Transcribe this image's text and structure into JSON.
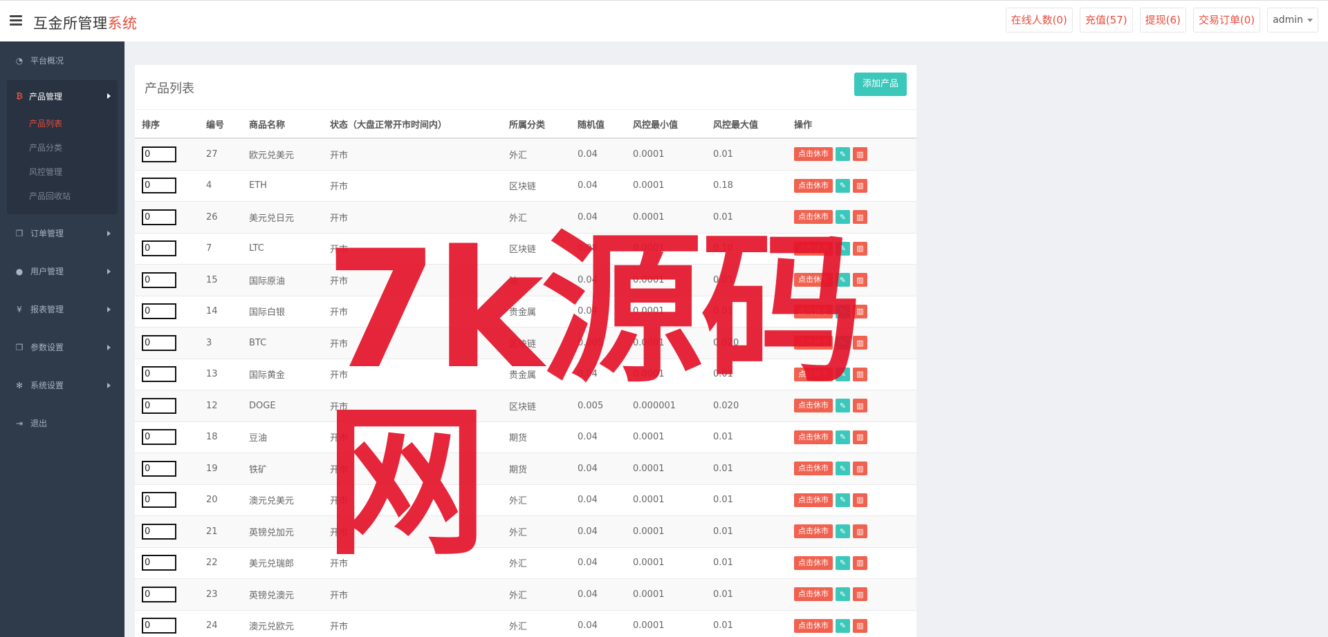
{
  "header": {
    "brand_main": "互金所管理",
    "brand_accent": "系统",
    "nav": [
      {
        "label": "在线人数(0)"
      },
      {
        "label": "充值(57)"
      },
      {
        "label": "提现(6)"
      },
      {
        "label": "交易订单(0)"
      }
    ],
    "user": "admin"
  },
  "sidebar": {
    "items_top": [
      {
        "label": "平台概况",
        "icon": "dashboard-icon"
      }
    ],
    "group": {
      "label": "产品管理",
      "icon": "bitcoin-icon",
      "children": [
        {
          "label": "产品列表",
          "active": true
        },
        {
          "label": "产品分类"
        },
        {
          "label": "风控管理"
        },
        {
          "label": "产品回收站"
        }
      ]
    },
    "items_bottom": [
      {
        "label": "订单管理",
        "icon": "copy-icon"
      },
      {
        "label": "用户管理",
        "icon": "user-icon"
      },
      {
        "label": "报表管理",
        "icon": "yen-icon"
      },
      {
        "label": "参数设置",
        "icon": "copy-icon"
      },
      {
        "label": "系统设置",
        "icon": "gears-icon"
      },
      {
        "label": "退出",
        "icon": "sign-out-icon"
      }
    ]
  },
  "panel": {
    "title": "产品列表",
    "add_label": "添加产品"
  },
  "table": {
    "headers": [
      "排序",
      "编号",
      "商品名称",
      "状态（大盘正常开市时间内）",
      "所属分类",
      "随机值",
      "风控最小值",
      "风控最大值",
      "操作"
    ],
    "close_label": "点击休市",
    "rows": [
      {
        "sort": "0",
        "id": "27",
        "name": "欧元兑美元",
        "status": "开市",
        "category": "外汇",
        "random": "0.04",
        "min": "0.0001",
        "max": "0.01"
      },
      {
        "sort": "0",
        "id": "4",
        "name": "ETH",
        "status": "开市",
        "category": "区块链",
        "random": "0.04",
        "min": "0.0001",
        "max": "0.18"
      },
      {
        "sort": "0",
        "id": "26",
        "name": "美元兑日元",
        "status": "开市",
        "category": "外汇",
        "random": "0.04",
        "min": "0.0001",
        "max": "0.01"
      },
      {
        "sort": "0",
        "id": "7",
        "name": "LTC",
        "status": "开市",
        "category": "区块链",
        "random": "0.08",
        "min": "0.0001",
        "max": "0.10"
      },
      {
        "sort": "0",
        "id": "15",
        "name": "国际原油",
        "status": "开市",
        "category": "油",
        "random": "0.04",
        "min": "0.0001",
        "max": "0.01"
      },
      {
        "sort": "0",
        "id": "14",
        "name": "国际白银",
        "status": "开市",
        "category": "贵金属",
        "random": "0.04",
        "min": "0.0001",
        "max": "0.01"
      },
      {
        "sort": "0",
        "id": "3",
        "name": "BTC",
        "status": "开市",
        "category": "区块链",
        "random": "0.005",
        "min": "0.0001",
        "max": "0.020"
      },
      {
        "sort": "0",
        "id": "13",
        "name": "国际黄金",
        "status": "开市",
        "category": "贵金属",
        "random": "0.04",
        "min": "0.0001",
        "max": "0.01"
      },
      {
        "sort": "0",
        "id": "12",
        "name": "DOGE",
        "status": "开市",
        "category": "区块链",
        "random": "0.005",
        "min": "0.000001",
        "max": "0.020"
      },
      {
        "sort": "0",
        "id": "18",
        "name": "豆油",
        "status": "开市",
        "category": "期货",
        "random": "0.04",
        "min": "0.0001",
        "max": "0.01"
      },
      {
        "sort": "0",
        "id": "19",
        "name": "铁矿",
        "status": "开市",
        "category": "期货",
        "random": "0.04",
        "min": "0.0001",
        "max": "0.01"
      },
      {
        "sort": "0",
        "id": "20",
        "name": "澳元兑美元",
        "status": "开市",
        "category": "外汇",
        "random": "0.04",
        "min": "0.0001",
        "max": "0.01"
      },
      {
        "sort": "0",
        "id": "21",
        "name": "英镑兑加元",
        "status": "开市",
        "category": "外汇",
        "random": "0.04",
        "min": "0.0001",
        "max": "0.01"
      },
      {
        "sort": "0",
        "id": "22",
        "name": "美元兑瑞郎",
        "status": "开市",
        "category": "外汇",
        "random": "0.04",
        "min": "0.0001",
        "max": "0.01"
      },
      {
        "sort": "0",
        "id": "23",
        "name": "英镑兑澳元",
        "status": "开市",
        "category": "外汇",
        "random": "0.04",
        "min": "0.0001",
        "max": "0.01"
      },
      {
        "sort": "0",
        "id": "24",
        "name": "澳元兑欧元",
        "status": "开市",
        "category": "外汇",
        "random": "0.04",
        "min": "0.0001",
        "max": "0.01"
      }
    ]
  },
  "watermark": "7k源码网"
}
